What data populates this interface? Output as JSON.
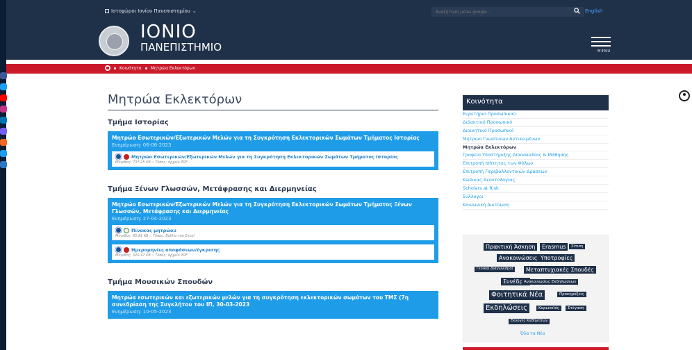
{
  "header": {
    "lang_menu": "Ιστοχώροι Ιονίου Πανεπιστημίου",
    "search_placeholder": "Αναζήτηση μέσω google...",
    "english": "English",
    "logo_title": "ΙΟΝΙΟ",
    "logo_sub": "ΠΑΝΕΠΙΣΤΗΜΙΟ",
    "menu": "MENU"
  },
  "breadcrumb": {
    "items": [
      "Κοινότητα",
      "Μητρώα Εκλεκτόρων"
    ]
  },
  "main": {
    "title": "Μητρώα Εκλεκτόρων",
    "sections": [
      {
        "title": "Τμήμα Ιστορίας",
        "card_title": "Μητρώο Εσωτερικών/Εξωτερικών Μελών για τη Συγκρότηση Εκλεκτορικών Σωμάτων Τμήματος Ιστορίας",
        "updated": "Ενημέρωση: 06-06-2023",
        "files": [
          {
            "name": "Μητρώο Εσωτερικών/Εξωτερικών Μελών για τη Συγκρότηση Εκλεκτορικών Σωμάτων Τμήματος Ιστορίας",
            "meta": "Μέγεθος: 737.25 KB :: Τύπος: Αρχείο PDF"
          }
        ]
      },
      {
        "title": "Τμήμα Ξένων Γλωσσών, Μετάφρασης και Διερμηνείας",
        "card_title": "Μητρώο Εσωτερικών/Εξωτερικών Μελών για τη Συγκρότηση Εκλεκτορικών Σωμάτων Τμήματος Ξένων Γλωσσών, Μετάφρασης και Διερμηνείας",
        "updated": "Ενημέρωση: 27-04-2023",
        "files": [
          {
            "name": "Πίνακας μητρώου",
            "meta": "Μέγεθος: 65.81 KB :: Τύπος: Βιβλίο του Excel"
          },
          {
            "name": "Ημερομηνίες αποφάσεων/έγκρισης",
            "meta": "Μέγεθος: 320.47 KB :: Τύπος: Αρχείο PDF"
          }
        ]
      },
      {
        "title": "Τμήμα Μουσικών Σπουδών",
        "card_title": "Μητρώα εσωτερικών και εξωτερικών μελών για τη συγκρότηση εκλεκτορικών σωμάτων του ΤΜΣ (7η συνεδρίαση της Συγκλήτου του ΙΠ, 30-03-2023",
        "updated": "Ενημέρωση: 10-05-2023"
      }
    ]
  },
  "sidebar": {
    "title": "Κοινότητα",
    "items": [
      "Ευρετήριο Προσωπικού",
      "Διδακτικό Προσωπικό",
      "Διοικητικό Προσωπικό",
      "Μητρώο Γνωστικών Αντικειμένων",
      "Μητρώα Εκλεκτόρων",
      "Γραφείο Υποστήριξης Διδασκαλίας & Μάθησης",
      "Επιτροπή Ισότητας των Φύλων",
      "Επιτροπή Περιβαλλοντικών Δράσεων",
      "Κώδικας Δεοντολογίας",
      "Scholars at Risk",
      "Σύλλογοι",
      "Κοινωνική Δικτύωση"
    ],
    "active_index": 4,
    "tags": [
      "Πρακτική Άσκηση",
      "Erasmus",
      "Σίτιση",
      "Ανακοινώσεις",
      "Υποτροφίες",
      "Γενικοί Διαγωνισμοί",
      "Μεταπτυχιακές Σπουδές",
      "Συνέδρια",
      "Ανακοινώσεις Εκδηλώσεων",
      "Φοιτητικά Νέα",
      "Προκηρύξεις",
      "Εκδηλώσεις",
      "Κορωνοϊός",
      "Στέγαση",
      "Εκλογές Καθηγητών"
    ],
    "all_news": "Όλα τα Νέα"
  },
  "colors": {
    "navy": "#1f3049",
    "red": "#cb1b2a",
    "blue": "#1e9ce8",
    "social": [
      "#3b5998",
      "#1da1f2",
      "#ff0000",
      "#c13584",
      "#0077b5",
      "#7360f2",
      "#f26522",
      "#1e9ce8",
      "#2b78c5"
    ]
  },
  "social_icons": [
    "facebook-icon",
    "twitter-icon",
    "youtube-icon",
    "instagram-icon",
    "linkedin-icon",
    "viber-icon",
    "rss-icon",
    "play-icon",
    "app-icon"
  ]
}
